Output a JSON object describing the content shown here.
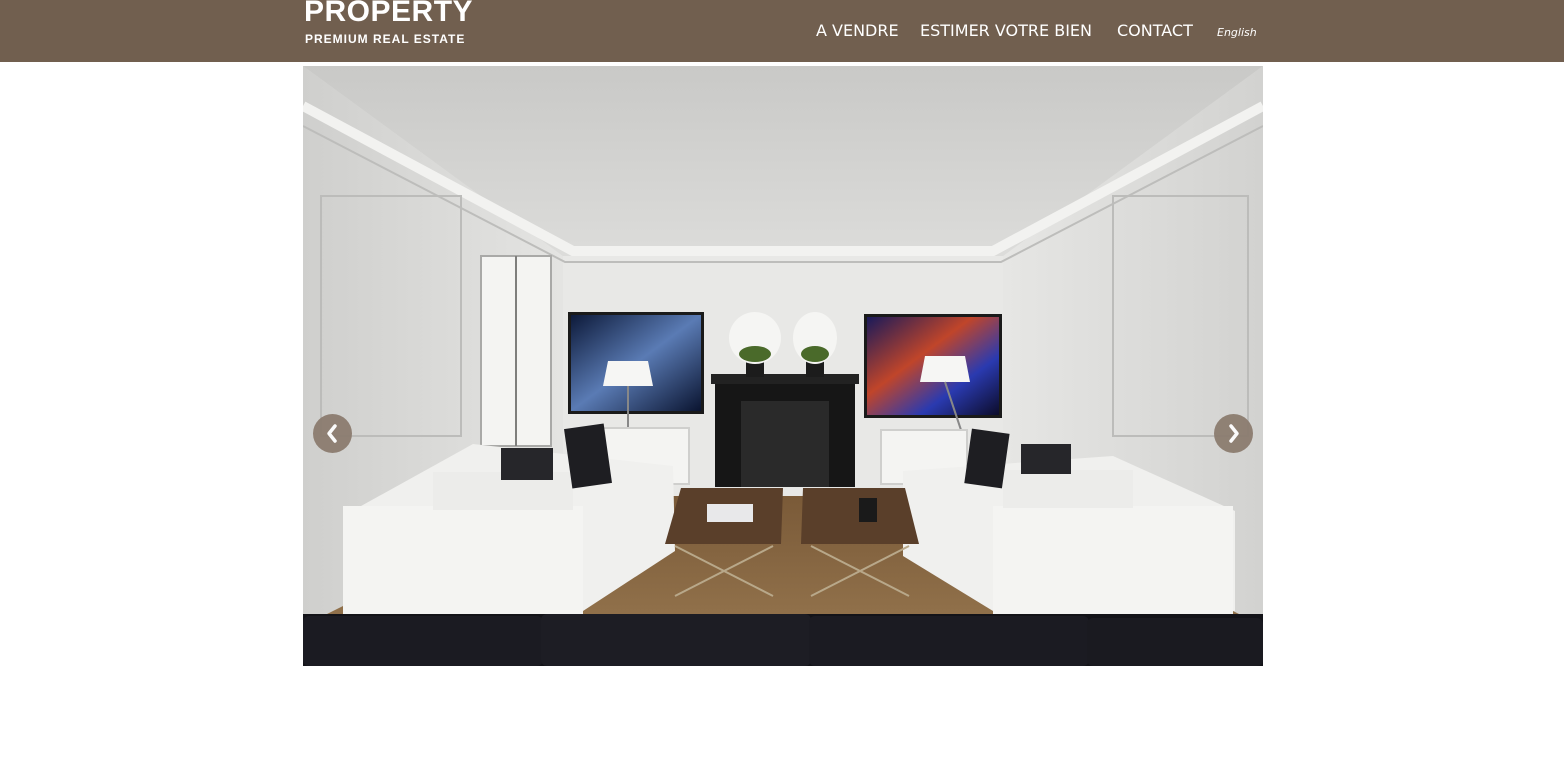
{
  "header": {
    "logo_title": "PROPERTY",
    "logo_subtitle": "PREMIUM REAL ESTATE",
    "nav": [
      "A VENDRE",
      "ESTIMER VOTRE BIEN",
      "CONTACT"
    ],
    "language": "English"
  },
  "slider": {
    "slide_count": 4,
    "active_slide": 1,
    "prev_icon": "chevron-left-icon",
    "next_icon": "chevron-right-icon"
  },
  "colors": {
    "header_bg": "#715f4f",
    "arrow_bg": "#8a7a6d",
    "text": "#ffffff"
  }
}
